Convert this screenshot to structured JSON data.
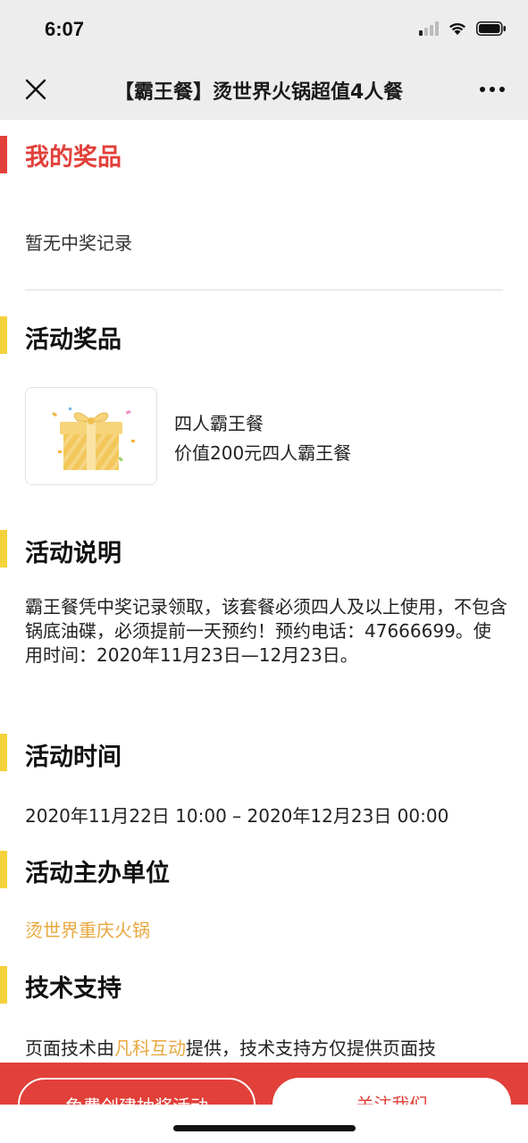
{
  "status_bar": {
    "time": "6:07"
  },
  "nav": {
    "title": "【霸王餐】烫世界火锅超值4人餐"
  },
  "sections": {
    "my_prizes": {
      "title": "我的奖品",
      "empty_text": "暂无中奖记录",
      "accent": "#e2403a"
    },
    "activity_prizes": {
      "title": "活动奖品",
      "accent": "#f5d23c"
    },
    "activity_desc": {
      "title": "活动说明"
    },
    "activity_time": {
      "title": "活动时间"
    },
    "organizer": {
      "title": "活动主办单位"
    },
    "tech_support": {
      "title": "技术支持"
    }
  },
  "prize": {
    "name": "四人霸王餐",
    "description": "价值200元四人霸王餐",
    "icon": "gift-box-icon"
  },
  "description": {
    "text": "霸王餐凭中奖记录领取，该套餐必须四人及以上使用，不包含锅底油碟，必须提前一天预约！预约电话：47666699。使用时间：2020年11月23日—12月23日。"
  },
  "time": {
    "range": "2020年11月22日 10:00 – 2020年12月23日 00:00"
  },
  "organizer": {
    "name": "烫世界重庆火锅",
    "color": "#e8a840"
  },
  "support": {
    "prefix": "页面技术由",
    "link": "凡科互动",
    "suffix": "提供，技术支持方仅提供页面技"
  },
  "bottom": {
    "create_label": "免费创建抽奖活动",
    "follow_label": "关注我们",
    "color": "#e2403a"
  }
}
